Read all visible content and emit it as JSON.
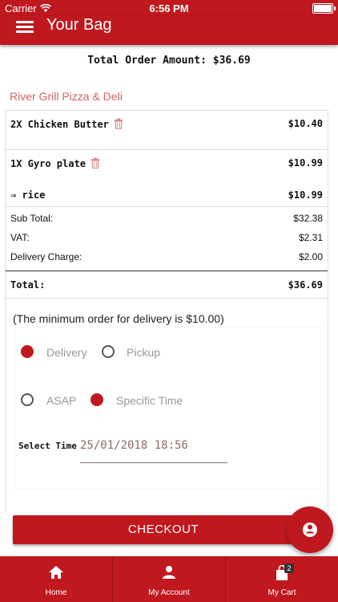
{
  "status": {
    "carrier": "Carrier",
    "time": "6:56 PM"
  },
  "header": {
    "title": "Your Bag"
  },
  "order": {
    "total_amount": "Total Order Amount: $36.69",
    "restaurant": "River Grill Pizza & Deli",
    "items": [
      {
        "name": "2X Chicken Butter",
        "price": "$10.40"
      },
      {
        "name": "1X Gyro plate",
        "price": "$10.99"
      },
      {
        "name": "⇒ rice",
        "price": "$10.99"
      }
    ],
    "summary": [
      {
        "label": "Sub Total:",
        "value": "$32.38"
      },
      {
        "label": "VAT:",
        "value": "$2.31"
      },
      {
        "label": "Delivery Charge:",
        "value": "$2.00"
      }
    ],
    "total": {
      "label": "Total:",
      "value": "$36.69"
    },
    "min_note": "(The minimum order for delivery is $10.00)"
  },
  "options": {
    "delivery": "Delivery",
    "pickup": "Pickup",
    "asap": "ASAP",
    "specific": "Specific Time",
    "select_time_label": "Select Time",
    "select_time_value": "25/01/2018 18:56"
  },
  "checkout_label": "CHECKOUT",
  "nav": {
    "home": "Home",
    "account": "My Account",
    "cart": "My Cart",
    "cart_count": "2"
  },
  "colors": {
    "brand": "#c0181f",
    "restaurant": "#d1636a"
  }
}
